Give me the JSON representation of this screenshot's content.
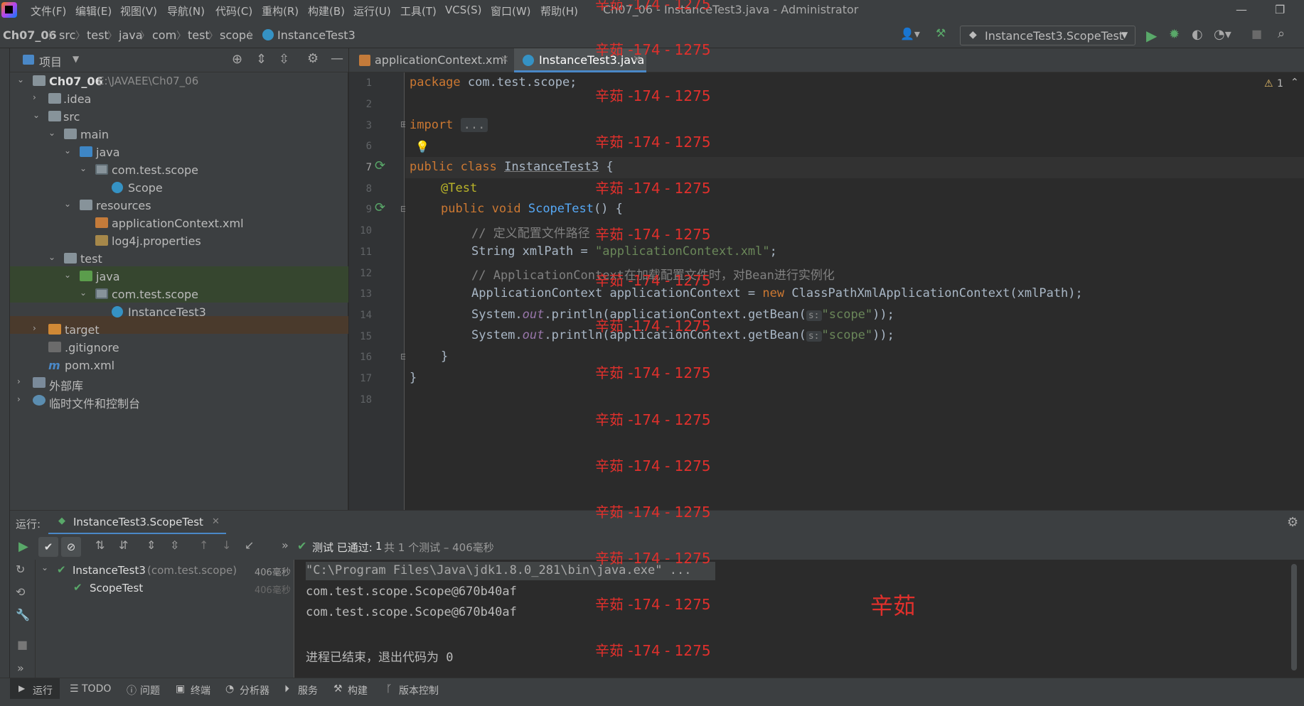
{
  "window": {
    "title": "Ch07_06 - InstanceTest3.java - Administrator",
    "menu": [
      "文件(F)",
      "编辑(E)",
      "视图(V)",
      "导航(N)",
      "代码(C)",
      "重构(R)",
      "构建(B)",
      "运行(U)",
      "工具(T)",
      "VCS(S)",
      "窗口(W)",
      "帮助(H)"
    ]
  },
  "breadcrumb": [
    "Ch07_06",
    "src",
    "test",
    "java",
    "com",
    "test",
    "scope",
    "InstanceTest3"
  ],
  "run_config": "InstanceTest3.ScopeTest",
  "project_panel": {
    "title": "项目",
    "root": {
      "name": "Ch07_06",
      "path": "E:\\JAVAEE\\Ch07_06"
    },
    "items": [
      ".idea",
      "src",
      "main",
      "java",
      "com.test.scope",
      "Scope",
      "resources",
      "applicationContext.xml",
      "log4j.properties",
      "test",
      "java",
      "com.test.scope",
      "InstanceTest3",
      "target",
      ".gitignore",
      "pom.xml",
      "外部库",
      "临时文件和控制台"
    ]
  },
  "editor": {
    "tabs": [
      "applicationContext.xml",
      "InstanceTest3.java"
    ],
    "active_tab": "InstanceTest3.java",
    "warning_count": "1",
    "line_numbers": [
      "1",
      "2",
      "3",
      "6",
      "7",
      "8",
      "9",
      "10",
      "11",
      "12",
      "13",
      "14",
      "15",
      "16",
      "17",
      "18"
    ],
    "code": {
      "l1_kw": "package",
      "l1_rest": " com.test.scope;",
      "l3_kw": "import",
      "l3_fold": "...",
      "l7_kw": "public class",
      "l7_cls": "InstanceTest3",
      "l7_rest": " {",
      "l8_ann": "@Test",
      "l9_kw": "public void",
      "l9_fn": "ScopeTest",
      "l9_rest": "() {",
      "l10_cmt": "// 定义配置文件路径",
      "l11_a": "String xmlPath = ",
      "l11_str": "\"applicationContext.xml\"",
      "l11_b": ";",
      "l12_cmt": "// ApplicationContext在加载配置文件时，对Bean进行实例化",
      "l13_a": "ApplicationContext applicationContext = ",
      "l13_kw": "new",
      "l13_b": " ClassPathXmlApplicationContext(xmlPath);",
      "println_a": "System.",
      "println_out": "out",
      "println_b": ".println(applicationContext.getBean(",
      "hint": "s:",
      "println_str": "\"scope\"",
      "println_c": "));",
      "l16": "}",
      "l17": "}"
    }
  },
  "watermark": {
    "text": "辛茹 -174 - 1275",
    "big": "辛茹"
  },
  "run_panel": {
    "label": "运行:",
    "tab": "InstanceTest3.ScopeTest",
    "status_prefix": "测试 已通过: ",
    "status_count": "1",
    "status_suffix": "共 1 个测试 – 406毫秒",
    "tests": [
      {
        "name": "InstanceTest3",
        "pkg": "(com.test.scope)",
        "time": "406毫秒"
      },
      {
        "name": "ScopeTest",
        "time": "406毫秒"
      }
    ],
    "console": [
      "\"C:\\Program Files\\Java\\jdk1.8.0_281\\bin\\java.exe\" ...",
      "com.test.scope.Scope@670b40af",
      "com.test.scope.Scope@670b40af",
      "",
      "进程已结束，退出代码为 0"
    ]
  },
  "bottom_tabs": [
    "运行",
    "TODO",
    "问题",
    "终端",
    "分析器",
    "服务",
    "构建",
    "版本控制"
  ],
  "colors": {
    "accent": "#4a88c7",
    "watermark": "#e0302c",
    "pass": "#59a869"
  }
}
